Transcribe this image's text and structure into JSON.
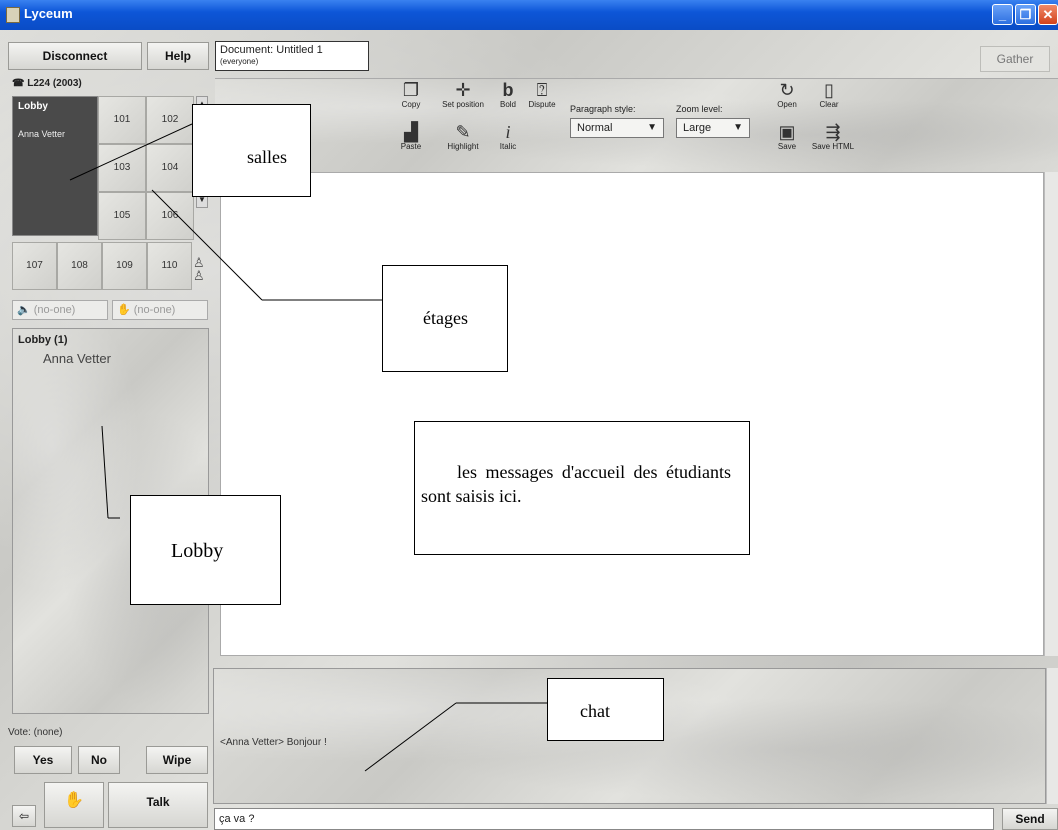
{
  "window": {
    "title": "Lyceum",
    "controls": [
      "minimize",
      "maximize",
      "close"
    ]
  },
  "top_bar": {
    "disconnect_label": "Disconnect",
    "help_label": "Help",
    "document_title": "Document: Untitled 1",
    "document_scope": "(everyone)",
    "gather_label": "Gather"
  },
  "floor": {
    "label": "L224 (2003)",
    "lobby_cell": {
      "title": "Lobby",
      "user": "Anna Vetter"
    },
    "rooms_right": [
      "101",
      "102",
      "103",
      "104",
      "105",
      "106"
    ],
    "rooms_bottom": [
      "107",
      "108",
      "109",
      "110"
    ]
  },
  "speakers": {
    "voice": "(no-one)",
    "hand": "(no-one)"
  },
  "lobby_panel": {
    "title": "Lobby (1)",
    "users": [
      "Anna Vetter"
    ]
  },
  "vote": {
    "label": "Vote: (none)",
    "yes_label": "Yes",
    "no_label": "No",
    "wipe_label": "Wipe"
  },
  "bottom_left": {
    "talk_label": "Talk"
  },
  "toolbar": {
    "copy": "Copy",
    "paste": "Paste",
    "set_position": "Set position",
    "highlight": "Highlight",
    "bold": "Bold",
    "italic": "Italic",
    "dispute": "Dispute",
    "paragraph_style_label": "Paragraph style:",
    "paragraph_style_value": "Normal",
    "zoom_label": "Zoom level:",
    "zoom_value": "Large",
    "open": "Open",
    "save": "Save",
    "clear": "Clear",
    "save_html": "Save HTML"
  },
  "chat": {
    "messages": [
      {
        "sender": "Anna Vetter",
        "text": "<Anna Vetter> Bonjour !"
      }
    ],
    "input_value": "ça va ?",
    "send_label": "Send"
  },
  "annotations": {
    "salles": "salles",
    "etages": "étages",
    "lobby": "Lobby",
    "messages": "les messages d'accueil des étudiants sont saisis ici.",
    "chat": "chat"
  }
}
